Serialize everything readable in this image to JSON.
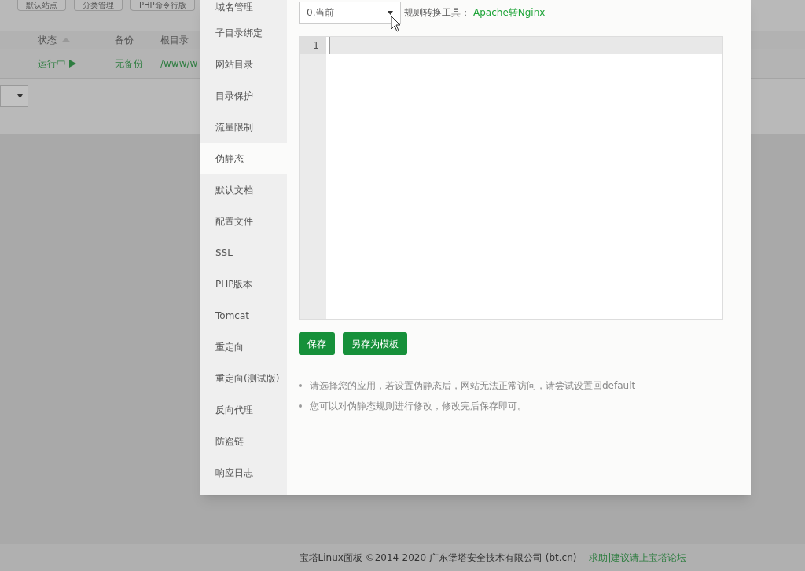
{
  "toolbar": {
    "buttons": [
      "默认站点",
      "分类管理",
      "PHP命令行版"
    ]
  },
  "table": {
    "columns": [
      {
        "label": "状态",
        "sorted": true
      },
      {
        "label": "备份",
        "sorted": false
      },
      {
        "label": "根目录",
        "sorted": false
      }
    ],
    "rows": [
      {
        "status": "运行中",
        "running": true,
        "backup": "无备份",
        "root": "/www/w"
      }
    ]
  },
  "dialog": {
    "sidebar": {
      "items": [
        {
          "label": "域名管理",
          "selected": false
        },
        {
          "label": "子目录绑定",
          "selected": false
        },
        {
          "label": "网站目录",
          "selected": false
        },
        {
          "label": "目录保护",
          "selected": false
        },
        {
          "label": "流量限制",
          "selected": false
        },
        {
          "label": "伪静态",
          "selected": true
        },
        {
          "label": "默认文档",
          "selected": false
        },
        {
          "label": "配置文件",
          "selected": false
        },
        {
          "label": "SSL",
          "selected": false
        },
        {
          "label": "PHP版本",
          "selected": false
        },
        {
          "label": "Tomcat",
          "selected": false
        },
        {
          "label": "重定向",
          "selected": false
        },
        {
          "label": "重定向(测试版)",
          "selected": false
        },
        {
          "label": "反向代理",
          "selected": false
        },
        {
          "label": "防盗链",
          "selected": false
        },
        {
          "label": "响应日志",
          "selected": false
        }
      ]
    },
    "template_select": {
      "value": "0.当前"
    },
    "tool_label": "规则转换工具：",
    "tool_link": "Apache转Nginx",
    "editor": {
      "line_numbers": [
        "1"
      ]
    },
    "buttons": [
      "保存",
      "另存为模板"
    ],
    "tips": [
      "请选择您的应用，若设置伪静态后，网站无法正常访问，请尝试设置回default",
      "您可以对伪静态规则进行修改，修改完后保存即可。"
    ]
  },
  "footer": {
    "copyright": "宝塔Linux面板 ©2014-2020 广东堡塔安全技术有限公司 (bt.cn)",
    "link": "求助|建议请上宝塔论坛"
  }
}
